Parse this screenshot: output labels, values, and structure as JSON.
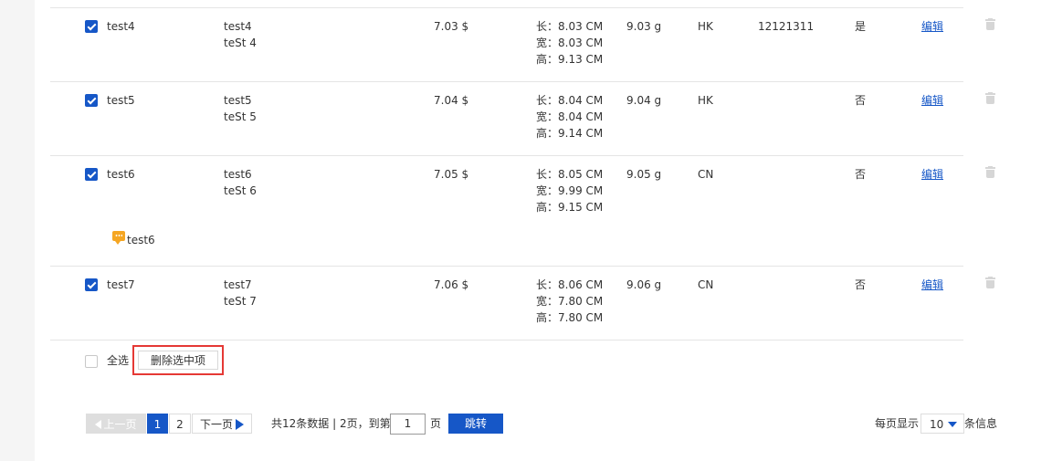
{
  "rows": [
    {
      "checked": true,
      "sku": "test4",
      "name_line1": "test4",
      "name_line2": "teSt 4",
      "price": "7.03 $",
      "dim_length": "长：8.03 CM",
      "dim_width": "宽：8.03 CM",
      "dim_height": "高：9.13 CM",
      "weight": "9.03 g",
      "origin": "HK",
      "hs_code": "12121311",
      "flag": "是",
      "edit_label": "编辑",
      "comment": ""
    },
    {
      "checked": true,
      "sku": "test5",
      "name_line1": "test5",
      "name_line2": "teSt 5",
      "price": "7.04 $",
      "dim_length": "长：8.04 CM",
      "dim_width": "宽：8.04 CM",
      "dim_height": "高：9.14 CM",
      "weight": "9.04 g",
      "origin": "HK",
      "hs_code": "",
      "flag": "否",
      "edit_label": "编辑",
      "comment": ""
    },
    {
      "checked": true,
      "sku": "test6",
      "name_line1": "test6",
      "name_line2": "teSt 6",
      "price": "7.05 $",
      "dim_length": "长：8.05 CM",
      "dim_width": "宽：9.99 CM",
      "dim_height": "高：9.15 CM",
      "weight": "9.05 g",
      "origin": "CN",
      "hs_code": "",
      "flag": "否",
      "edit_label": "编辑",
      "comment": "test6"
    },
    {
      "checked": true,
      "sku": "test7",
      "name_line1": "test7",
      "name_line2": "teSt 7",
      "price": "7.06 $",
      "dim_length": "长：8.06 CM",
      "dim_width": "宽：7.80 CM",
      "dim_height": "高：7.80 CM",
      "weight": "9.06 g",
      "origin": "CN",
      "hs_code": "",
      "flag": "否",
      "edit_label": "编辑",
      "comment": ""
    }
  ],
  "footer": {
    "select_all_label": "全选",
    "select_all_checked": false,
    "delete_selected_label": "删除选中项"
  },
  "pagination": {
    "prev_label": "上一页",
    "pages": [
      "1",
      "2"
    ],
    "current_page": "1",
    "next_label": "下一页",
    "summary": "共12条数据 | 2页，到第",
    "jump_value": "1",
    "page_suffix": "页",
    "jump_button": "跳转",
    "per_page_prefix": "每页显示",
    "per_page_value": "10",
    "per_page_suffix": "条信息"
  },
  "colors": {
    "accent": "#1657c7",
    "highlight_border": "#e53935",
    "comment_icon": "#f5a623"
  }
}
